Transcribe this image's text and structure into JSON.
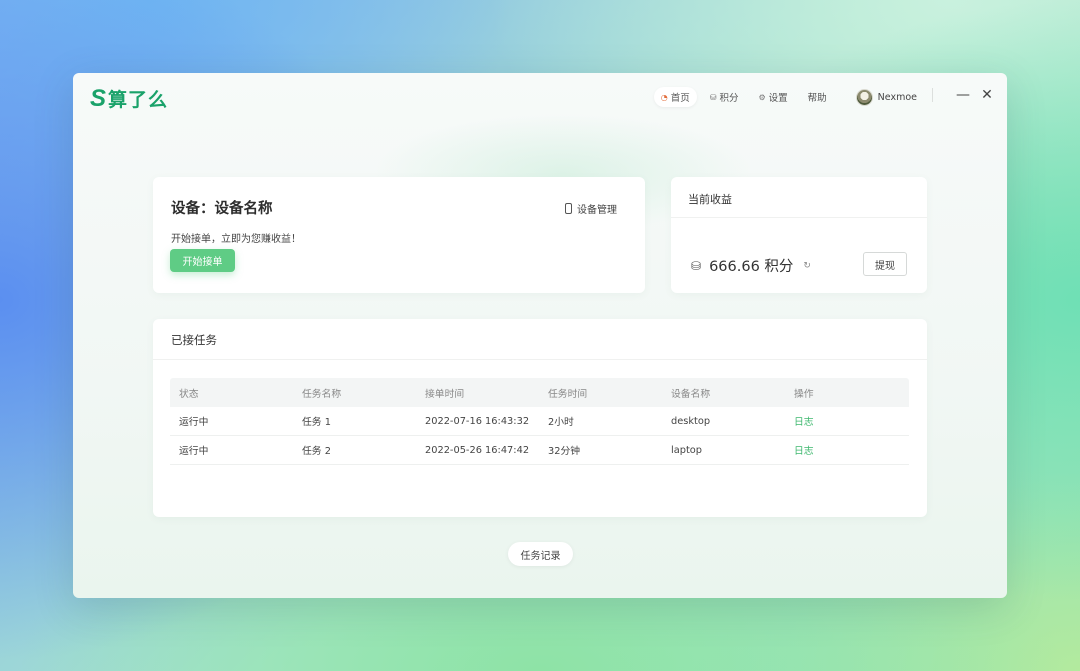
{
  "app": {
    "logo_mark": "S",
    "logo_text": "算了么"
  },
  "nav": {
    "items": [
      {
        "label": "首页",
        "icon": "home-icon",
        "active": true
      },
      {
        "label": "积分",
        "icon": "points-icon",
        "active": false
      },
      {
        "label": "设置",
        "icon": "settings-icon",
        "active": false
      },
      {
        "label": "帮助",
        "icon": "",
        "active": false
      }
    ],
    "user": {
      "name": "Nexmoe"
    }
  },
  "device": {
    "title": "设备：设备名称",
    "subtitle": "开始接单，立即为您赚收益！",
    "start_label": "开始接单",
    "manage_label": "设备管理"
  },
  "income": {
    "title": "当前收益",
    "value": "666.66 积分",
    "withdraw_label": "提现"
  },
  "tasks": {
    "title": "已接任务",
    "columns": [
      "状态",
      "任务名称",
      "接单时间",
      "任务时间",
      "设备名称",
      "操作"
    ],
    "rows": [
      [
        "运行中",
        "任务 1",
        "2022-07-16 16:43:32",
        "2小时",
        "desktop",
        "日志"
      ],
      [
        "运行中",
        "任务 2",
        "2022-05-26 16:47:42",
        "32分钟",
        "laptop",
        "日志"
      ]
    ]
  },
  "history_label": "任务记录",
  "colors": {
    "accent": "#1aa26a",
    "button_green": "#5fcc85",
    "link_green": "#3fb86f"
  }
}
